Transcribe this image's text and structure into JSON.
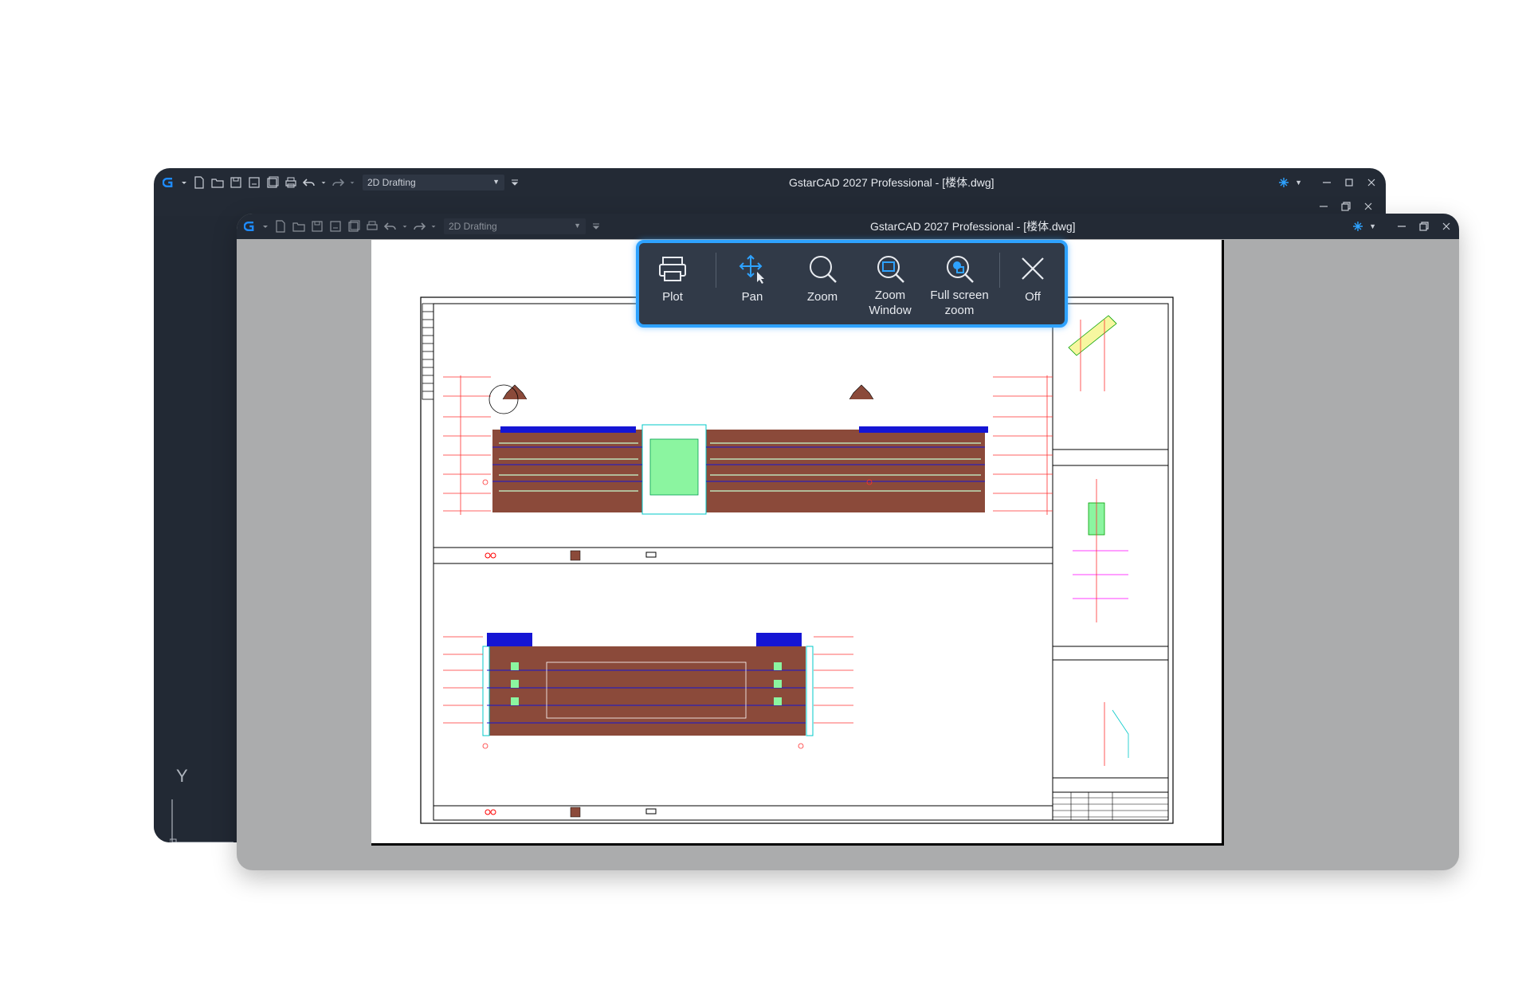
{
  "back_window": {
    "title": "GstarCAD 2027 Professional - [楼体.dwg]",
    "workspace": "2D Drafting",
    "ucs_y_label": "Y"
  },
  "front_window": {
    "title": "GstarCAD 2027 Professional - [楼体.dwg]",
    "workspace": "2D Drafting"
  },
  "toolbar": {
    "plot": "Plot",
    "pan": "Pan",
    "zoom": "Zoom",
    "zoom_window_1": "Zoom",
    "zoom_window_2": "Window",
    "full_screen_1": "Full screen",
    "full_screen_2": "zoom",
    "off": "Off"
  },
  "colors": {
    "titlebar": "#232a35",
    "toolbar_bg": "#313a48",
    "toolbar_border": "#2ea2ff",
    "brand_blue": "#1e8bff",
    "canvas_gray": "#abacad"
  },
  "icons": [
    "gstar-logo-icon",
    "new-file-icon",
    "open-folder-icon",
    "save-icon",
    "save-as-icon",
    "batch-save-icon",
    "print-icon",
    "undo-icon",
    "redo-icon",
    "workspace-dropdown-icon",
    "customize-icon",
    "app-switch-icon",
    "minimize-icon",
    "restore-icon",
    "close-icon",
    "plot-icon",
    "pan-icon",
    "zoom-icon",
    "zoom-window-icon",
    "full-screen-zoom-icon",
    "off-icon"
  ]
}
